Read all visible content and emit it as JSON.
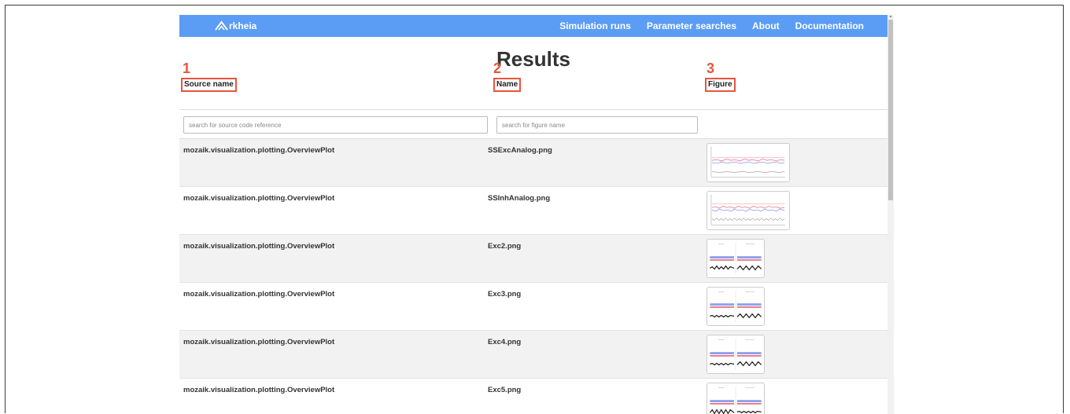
{
  "navbar": {
    "brand": "rkheia",
    "links": [
      "Simulation runs",
      "Parameter searches",
      "About",
      "Documentation"
    ]
  },
  "page": {
    "title": "Results"
  },
  "annotations": [
    "1",
    "2",
    "3"
  ],
  "columns": {
    "source": "Source name",
    "name": "Name",
    "figure": "Figure"
  },
  "search": {
    "source_placeholder": "search for source code reference",
    "name_placeholder": "search for figure name"
  },
  "rows": [
    {
      "source": "mozaik.visualization.plotting.OverviewPlot",
      "name": "SSExcAnalog.png",
      "thumb": "wide"
    },
    {
      "source": "mozaik.visualization.plotting.OverviewPlot",
      "name": "SSInhAnalog.png",
      "thumb": "wide"
    },
    {
      "source": "mozaik.visualization.plotting.OverviewPlot",
      "name": "Exc2.png",
      "thumb": "square"
    },
    {
      "source": "mozaik.visualization.plotting.OverviewPlot",
      "name": "Exc3.png",
      "thumb": "square"
    },
    {
      "source": "mozaik.visualization.plotting.OverviewPlot",
      "name": "Exc4.png",
      "thumb": "square"
    },
    {
      "source": "mozaik.visualization.plotting.OverviewPlot",
      "name": "Exc5.png",
      "thumb": "square"
    }
  ],
  "colors": {
    "navbar": "#5b9cf5",
    "annotation": "#e8553e"
  }
}
